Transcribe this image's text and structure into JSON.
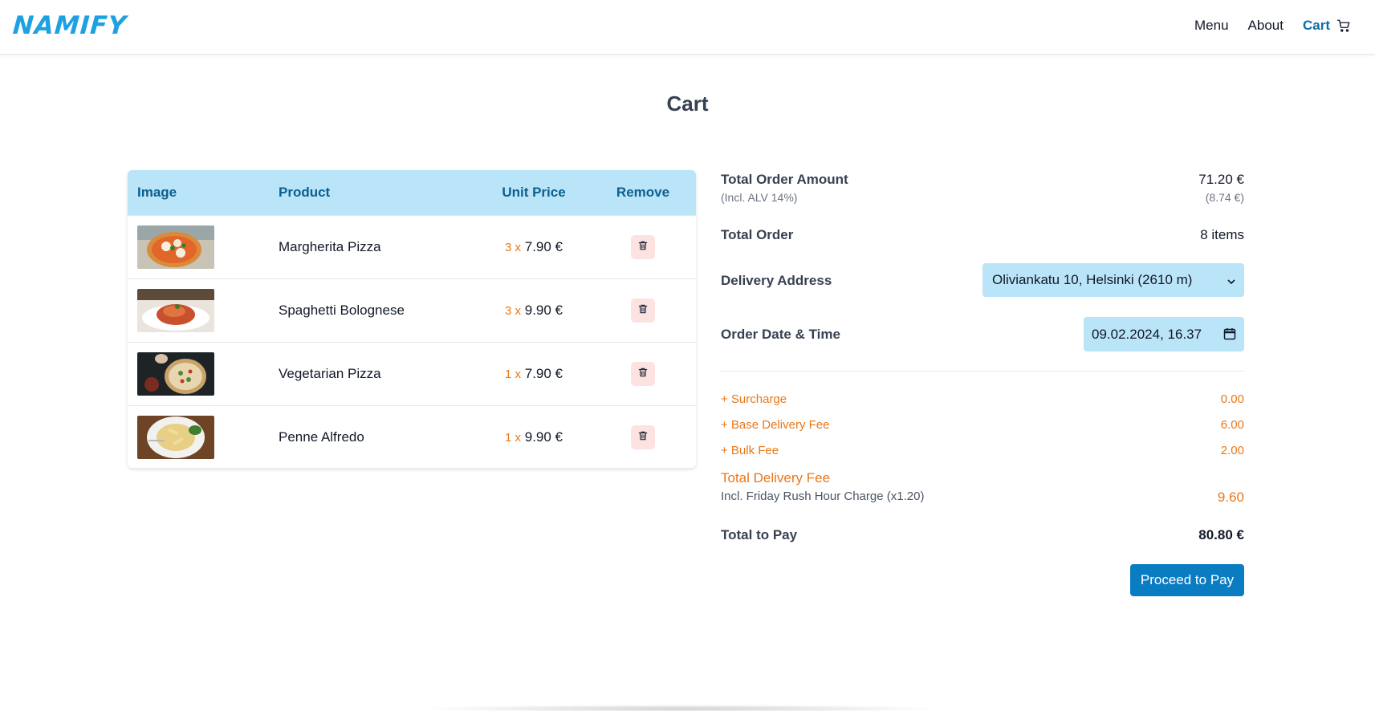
{
  "brand": {
    "logo": "NAMIFY"
  },
  "nav": {
    "items": [
      {
        "label": "Menu"
      },
      {
        "label": "About"
      }
    ],
    "cart_label": "Cart",
    "cart_icon": "cart-icon"
  },
  "page": {
    "title": "Cart"
  },
  "table": {
    "headers": {
      "image": "Image",
      "product": "Product",
      "unit_price": "Unit Price",
      "remove": "Remove"
    },
    "rows": [
      {
        "product": "Margherita Pizza",
        "qty": "3 x",
        "price": "7.90 €",
        "image": "margherita-pizza-photo"
      },
      {
        "product": "Spaghetti Bolognese",
        "qty": "3 x",
        "price": "9.90 €",
        "image": "spaghetti-bolognese-photo"
      },
      {
        "product": "Vegetarian Pizza",
        "qty": "1 x",
        "price": "7.90 €",
        "image": "vegetarian-pizza-photo"
      },
      {
        "product": "Penne Alfredo",
        "qty": "1 x",
        "price": "9.90 €",
        "image": "penne-alfredo-photo"
      }
    ]
  },
  "summary": {
    "total_order_amount_label": "Total Order Amount",
    "total_order_amount": "71.20 €",
    "vat_label": "(Incl. ALV 14%)",
    "vat_amount": "(8.74 €)",
    "total_order_label": "Total Order",
    "total_order_value": "8 items",
    "delivery_address_label": "Delivery Address",
    "delivery_address_value": "Oliviankatu 10, Helsinki (2610 m)",
    "order_datetime_label": "Order Date & Time",
    "order_datetime_value": "09.02.2024, 16.37",
    "surcharge_label": "+ Surcharge",
    "surcharge_value": "0.00",
    "base_fee_label": "+ Base Delivery Fee",
    "base_fee_value": "6.00",
    "bulk_fee_label": "+ Bulk Fee",
    "bulk_fee_value": "2.00",
    "total_delivery_fee_label": "Total Delivery Fee",
    "rush_hour_label": "Incl. Friday Rush Hour Charge (x1.20)",
    "total_delivery_fee_value": "9.60",
    "total_to_pay_label": "Total to Pay",
    "total_to_pay_value": "80.80 €",
    "pay_button": "Proceed to Pay"
  },
  "colors": {
    "accent": "#0a7dc2",
    "header_bg": "#bae4f8",
    "fee": "#e8781a",
    "logo": "#1da1e2"
  }
}
